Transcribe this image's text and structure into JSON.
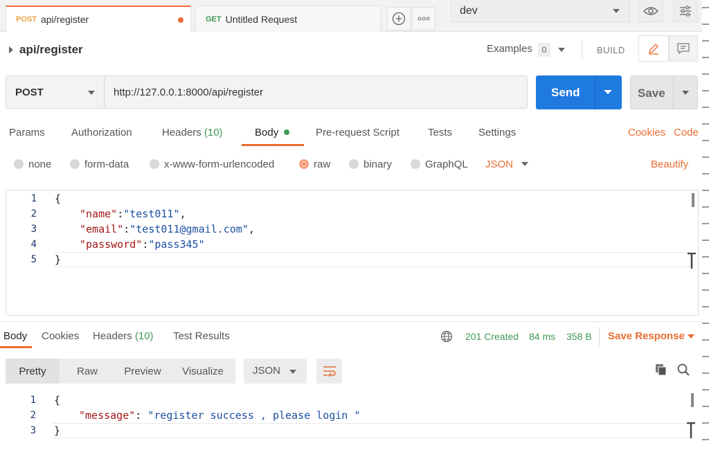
{
  "tabs": [
    {
      "method": "POST",
      "label": "api/register"
    },
    {
      "method": "GET",
      "label": "Untitled Request"
    }
  ],
  "environment": {
    "selected": "dev"
  },
  "request": {
    "name": "api/register",
    "examples_label": "Examples",
    "examples_count": "0",
    "build_label": "BUILD",
    "method": "POST",
    "url": "http://127.0.0.1:8000/api/register",
    "send_label": "Send",
    "save_label": "Save"
  },
  "request_tabs": {
    "params": "Params",
    "authorization": "Authorization",
    "headers": "Headers",
    "headers_count": "(10)",
    "body": "Body",
    "prerequest": "Pre-request Script",
    "tests": "Tests",
    "settings": "Settings",
    "cookies": "Cookies",
    "code": "Code"
  },
  "body_modes": {
    "none": "none",
    "form_data": "form-data",
    "urlencoded": "x-www-form-urlencoded",
    "raw": "raw",
    "binary": "binary",
    "graphql": "GraphQL",
    "format": "JSON",
    "beautify": "Beautify",
    "selected": "raw"
  },
  "request_body": {
    "line_numbers": [
      "1",
      "2",
      "3",
      "4",
      "5"
    ],
    "lines": [
      {
        "open": "{"
      },
      {
        "key": "\"name\"",
        "sep": ":",
        "value": "\"test011\"",
        "end": ","
      },
      {
        "key": "\"email\"",
        "sep": ":",
        "value": "\"test011@gmail.com\"",
        "end": ","
      },
      {
        "key": "\"password\"",
        "sep": ":",
        "value": "\"pass345\"",
        "end": ""
      },
      {
        "close": "}"
      }
    ]
  },
  "response": {
    "tabs": {
      "body": "Body",
      "cookies": "Cookies",
      "headers": "Headers",
      "headers_count": "(10)",
      "test_results": "Test Results"
    },
    "status": "201 Created",
    "time": "84 ms",
    "size": "358 B",
    "save_response": "Save Response",
    "views": {
      "pretty": "Pretty",
      "raw": "Raw",
      "preview": "Preview",
      "visualize": "Visualize"
    },
    "format": "JSON",
    "line_numbers": [
      "1",
      "2",
      "3"
    ],
    "open": "{",
    "key": "\"message\"",
    "sep": ": ",
    "value": "\"register success , please login \"",
    "close": "}"
  },
  "colors": {
    "accent": "#e86d33",
    "send_blue": "#1f7ae0",
    "status_green": "#3f9a55"
  }
}
